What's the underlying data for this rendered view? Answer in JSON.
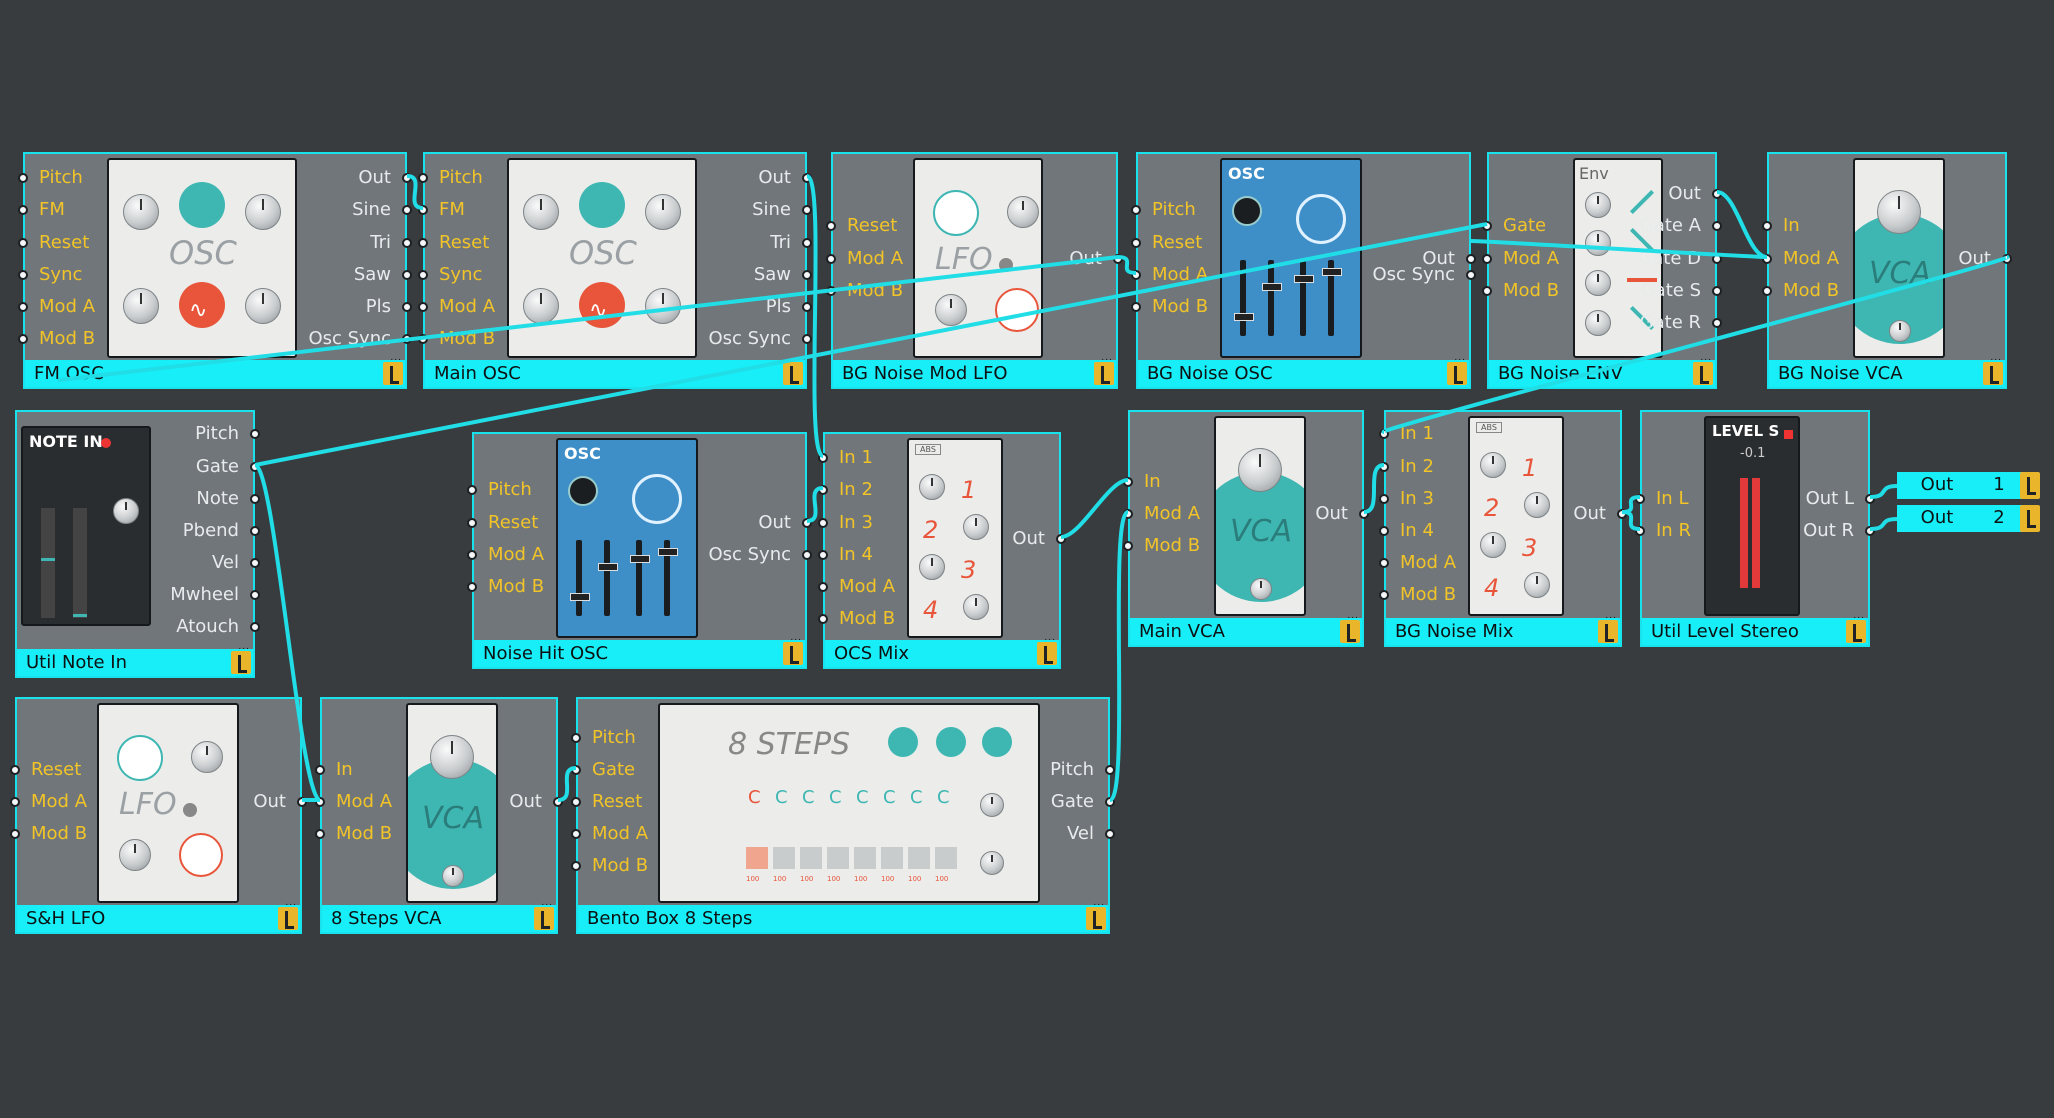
{
  "modules": {
    "fm_osc": {
      "title": "FM OSC",
      "inputs": [
        "Pitch",
        "FM",
        "Reset",
        "Sync",
        "Mod A",
        "Mod B"
      ],
      "outputs": [
        "Out",
        "Sine",
        "Tri",
        "Saw",
        "Pls",
        "Osc Sync"
      ],
      "panel_name": "OSC"
    },
    "main_osc": {
      "title": "Main OSC",
      "inputs": [
        "Pitch",
        "FM",
        "Reset",
        "Sync",
        "Mod A",
        "Mod B"
      ],
      "outputs": [
        "Out",
        "Sine",
        "Tri",
        "Saw",
        "Pls",
        "Osc Sync"
      ],
      "panel_name": "OSC"
    },
    "bg_noise_mod_lfo": {
      "title": "BG Noise Mod LFO",
      "inputs": [
        "Reset",
        "Mod A",
        "Mod B"
      ],
      "outputs": [
        "Out"
      ],
      "panel_name": "LFO"
    },
    "bg_noise_osc": {
      "title": "BG Noise OSC",
      "inputs": [
        "Pitch",
        "Reset",
        "Mod A",
        "Mod B"
      ],
      "outputs": [
        "Out",
        "Osc Sync"
      ],
      "panel_name": "OSC"
    },
    "bg_noise_env": {
      "title": "BG Noise ENV",
      "inputs": [
        "Gate",
        "Mod A",
        "Mod B"
      ],
      "outputs": [
        "Out",
        "Gate A",
        "Gate D",
        "Gate S",
        "Gate R"
      ],
      "panel_name": "Env"
    },
    "bg_noise_vca": {
      "title": "BG Noise VCA",
      "inputs": [
        "In",
        "Mod A",
        "Mod B"
      ],
      "outputs": [
        "Out"
      ],
      "panel_name": "VCA"
    },
    "util_note_in": {
      "title": "Util Note In",
      "inputs": [],
      "outputs": [
        "Pitch",
        "Gate",
        "Note",
        "Pbend",
        "Vel",
        "Mwheel",
        "Atouch"
      ],
      "panel_name": "NOTE IN"
    },
    "noise_hit_osc": {
      "title": "Noise Hit OSC",
      "inputs": [
        "Pitch",
        "Reset",
        "Mod A",
        "Mod B"
      ],
      "outputs": [
        "Out",
        "Osc Sync"
      ],
      "panel_name": "OSC"
    },
    "ocs_mix": {
      "title": "OCS Mix",
      "inputs": [
        "In 1",
        "In 2",
        "In 3",
        "In 4",
        "Mod A",
        "Mod B"
      ],
      "outputs": [
        "Out"
      ],
      "panel_name": "ABS"
    },
    "main_vca": {
      "title": "Main VCA",
      "inputs": [
        "In",
        "Mod A",
        "Mod B"
      ],
      "outputs": [
        "Out"
      ],
      "panel_name": "VCA"
    },
    "bg_noise_mix": {
      "title": "BG Noise Mix",
      "inputs": [
        "In 1",
        "In 2",
        "In 3",
        "In 4",
        "Mod A",
        "Mod B"
      ],
      "outputs": [
        "Out"
      ],
      "panel_name": "ABS"
    },
    "util_level_stereo": {
      "title": "Util Level Stereo",
      "inputs": [
        "In L",
        "In R"
      ],
      "outputs": [
        "Out L",
        "Out R"
      ],
      "panel_name": "LEVEL S"
    },
    "sh_lfo": {
      "title": "S&H LFO",
      "inputs": [
        "Reset",
        "Mod A",
        "Mod B"
      ],
      "outputs": [
        "Out"
      ],
      "panel_name": "LFO"
    },
    "steps_vca": {
      "title": "8 Steps VCA",
      "inputs": [
        "In",
        "Mod A",
        "Mod B"
      ],
      "outputs": [
        "Out"
      ],
      "panel_name": "VCA"
    },
    "bento_box": {
      "title": "Bento Box 8 Steps",
      "inputs": [
        "Pitch",
        "Gate",
        "Reset",
        "Mod A",
        "Mod B"
      ],
      "outputs": [
        "Pitch",
        "Gate",
        "Vel"
      ],
      "panel_name": "8 STEPS"
    }
  },
  "outputs_panel": {
    "out1_label": "Out",
    "out1_num": "1",
    "out2_label": "Out",
    "out2_num": "2"
  },
  "level_display": "-0.1",
  "steps_notes": [
    "C",
    "C",
    "C",
    "C",
    "C",
    "C",
    "C",
    "C"
  ],
  "steps_velocity": [
    "100",
    "100",
    "100",
    "100",
    "100",
    "100",
    "100",
    "100"
  ],
  "colors": {
    "background": "#383c3f",
    "module_body": "#70767a",
    "accent_cyan": "#18eef7",
    "input_label": "#f2c428",
    "output_label": "#e8ebec",
    "wire": "#20dde6"
  }
}
